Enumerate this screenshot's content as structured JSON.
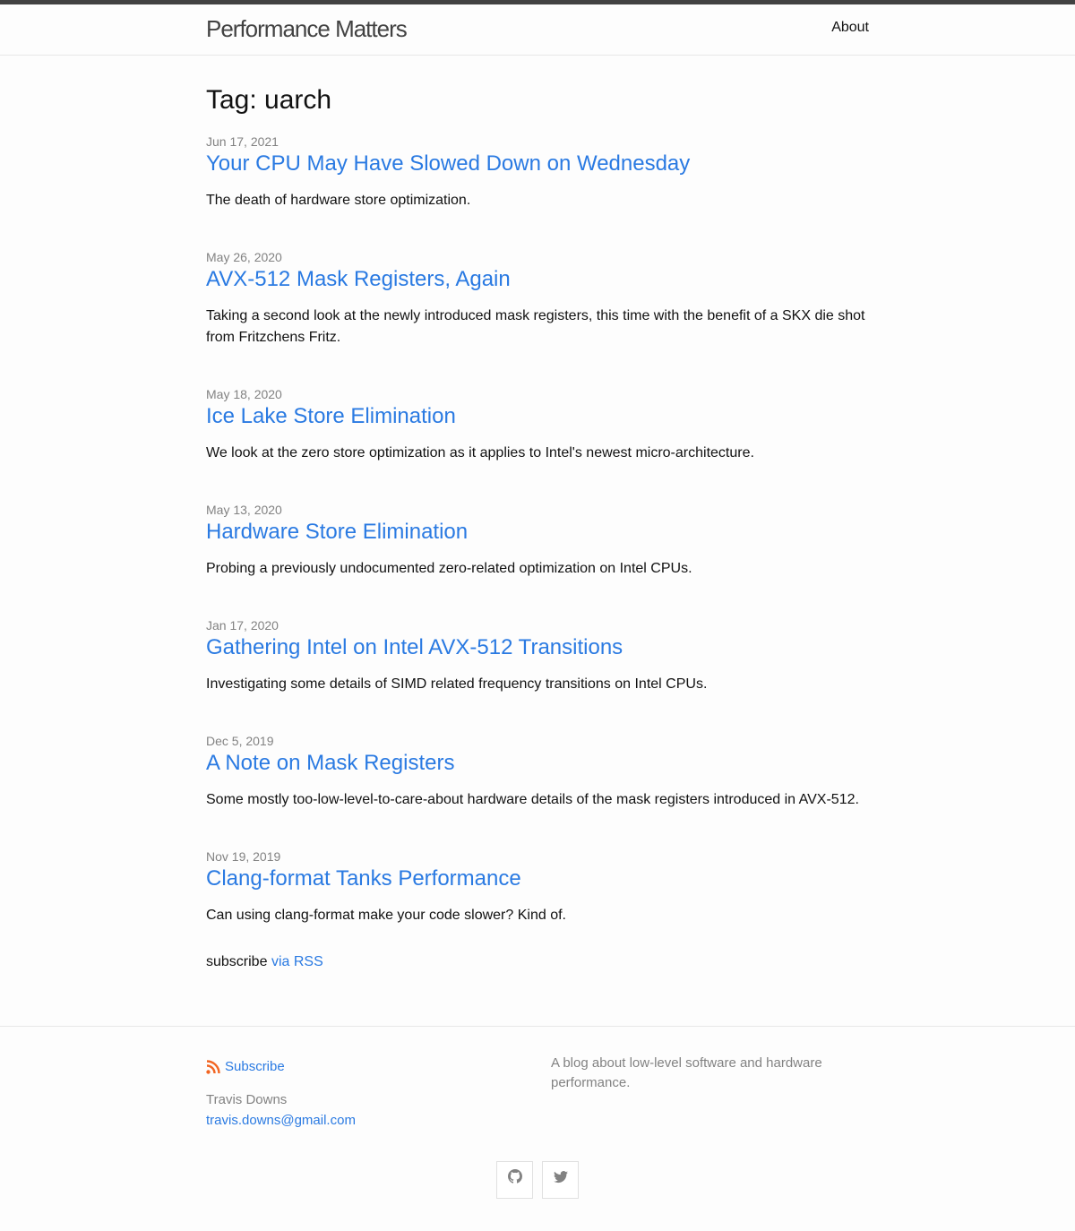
{
  "site": {
    "title": "Performance Matters",
    "nav_about": "About"
  },
  "page": {
    "heading": "Tag: uarch"
  },
  "posts": [
    {
      "date": "Jun 17, 2021",
      "title": "Your CPU May Have Slowed Down on Wednesday",
      "excerpt": "The death of hardware store optimization."
    },
    {
      "date": "May 26, 2020",
      "title": "AVX-512 Mask Registers, Again",
      "excerpt": "Taking a second look at the newly introduced mask registers, this time with the benefit of a SKX die shot from Fritzchens Fritz."
    },
    {
      "date": "May 18, 2020",
      "title": "Ice Lake Store Elimination",
      "excerpt": "We look at the zero store optimization as it applies to Intel's newest micro-architecture."
    },
    {
      "date": "May 13, 2020",
      "title": "Hardware Store Elimination",
      "excerpt": "Probing a previously undocumented zero-related optimization on Intel CPUs."
    },
    {
      "date": "Jan 17, 2020",
      "title": "Gathering Intel on Intel AVX-512 Transitions",
      "excerpt": "Investigating some details of SIMD related frequency transitions on Intel CPUs."
    },
    {
      "date": "Dec 5, 2019",
      "title": "A Note on Mask Registers",
      "excerpt": "Some mostly too-low-level-to-care-about hardware details of the mask registers introduced in AVX-512."
    },
    {
      "date": "Nov 19, 2019",
      "title": "Clang-format Tanks Performance",
      "excerpt": "Can using clang-format make your code slower? Kind of."
    }
  ],
  "subscribe": {
    "prefix": "subscribe",
    "link": "via RSS"
  },
  "footer": {
    "subscribe_label": "Subscribe",
    "rss_icon": "rss-icon",
    "author_name": "Travis Downs",
    "author_email": "travis.downs@gmail.com",
    "description": "A blog about low-level software and hardware performance.",
    "social": [
      {
        "icon": "github-icon"
      },
      {
        "icon": "twitter-icon"
      }
    ]
  },
  "colors": {
    "link": "#2a7ae2",
    "meta": "#828282",
    "rss": "#f26522",
    "topbar": "#424242"
  }
}
